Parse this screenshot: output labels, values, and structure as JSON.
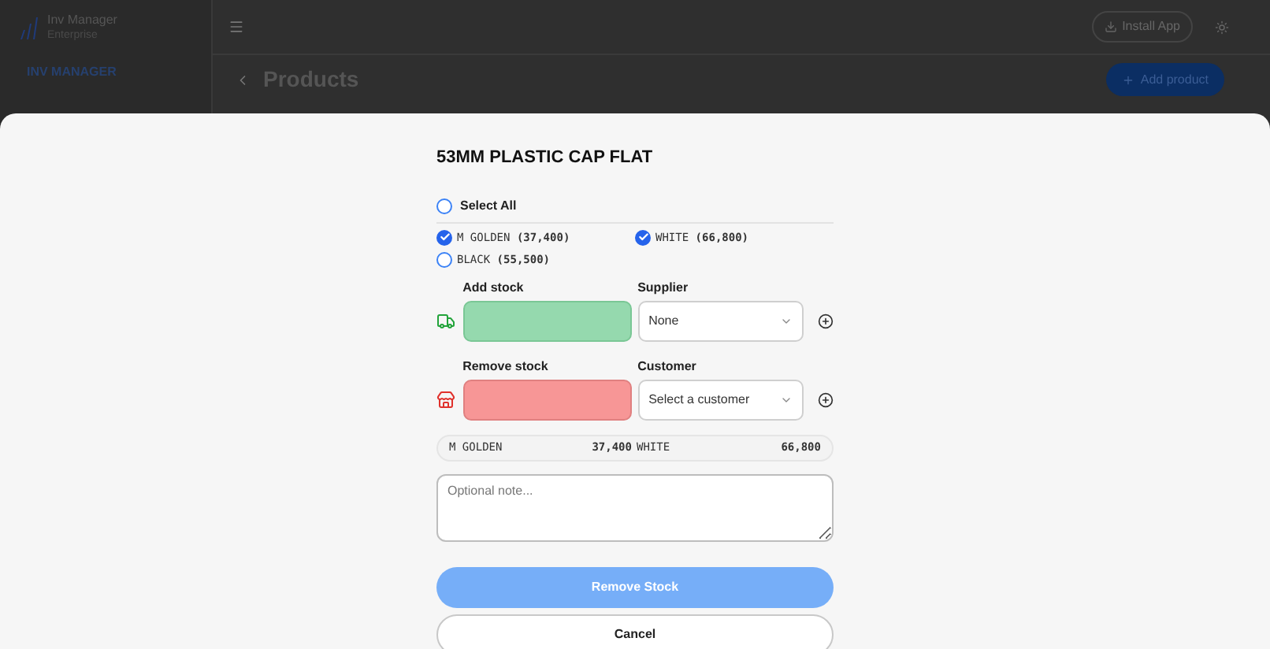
{
  "app": {
    "name": "Inv Manager",
    "edition": "Enterprise",
    "section": "INV MANAGER"
  },
  "header": {
    "install_button": "Install App"
  },
  "page": {
    "title": "Products",
    "add_button": "Add product"
  },
  "sheet": {
    "title": "53MM PLASTIC CAP FLAT",
    "select_all": {
      "label": "Select All",
      "checked": false
    },
    "variants": [
      {
        "name": "M GOLDEN",
        "count": "(37,400)",
        "selected": true
      },
      {
        "name": "WHITE",
        "count": "(66,800)",
        "selected": true
      },
      {
        "name": "BLACK",
        "count": "(55,500)",
        "selected": false
      }
    ],
    "stock_rows": [
      {
        "kind": "add",
        "label": "Add stock",
        "party_label": "Supplier",
        "party_value": "None"
      },
      {
        "kind": "remove",
        "label": "Remove stock",
        "party_label": "Customer",
        "party_value": "Select a customer"
      }
    ],
    "summary": [
      {
        "name": "M GOLDEN",
        "qty": "37,400"
      },
      {
        "name": "WHITE",
        "qty": "66,800"
      }
    ],
    "note": {
      "placeholder": "Optional note..."
    },
    "primary_button": {
      "label": "Remove Stock",
      "disabled": true
    },
    "cancel_button": "Cancel"
  }
}
